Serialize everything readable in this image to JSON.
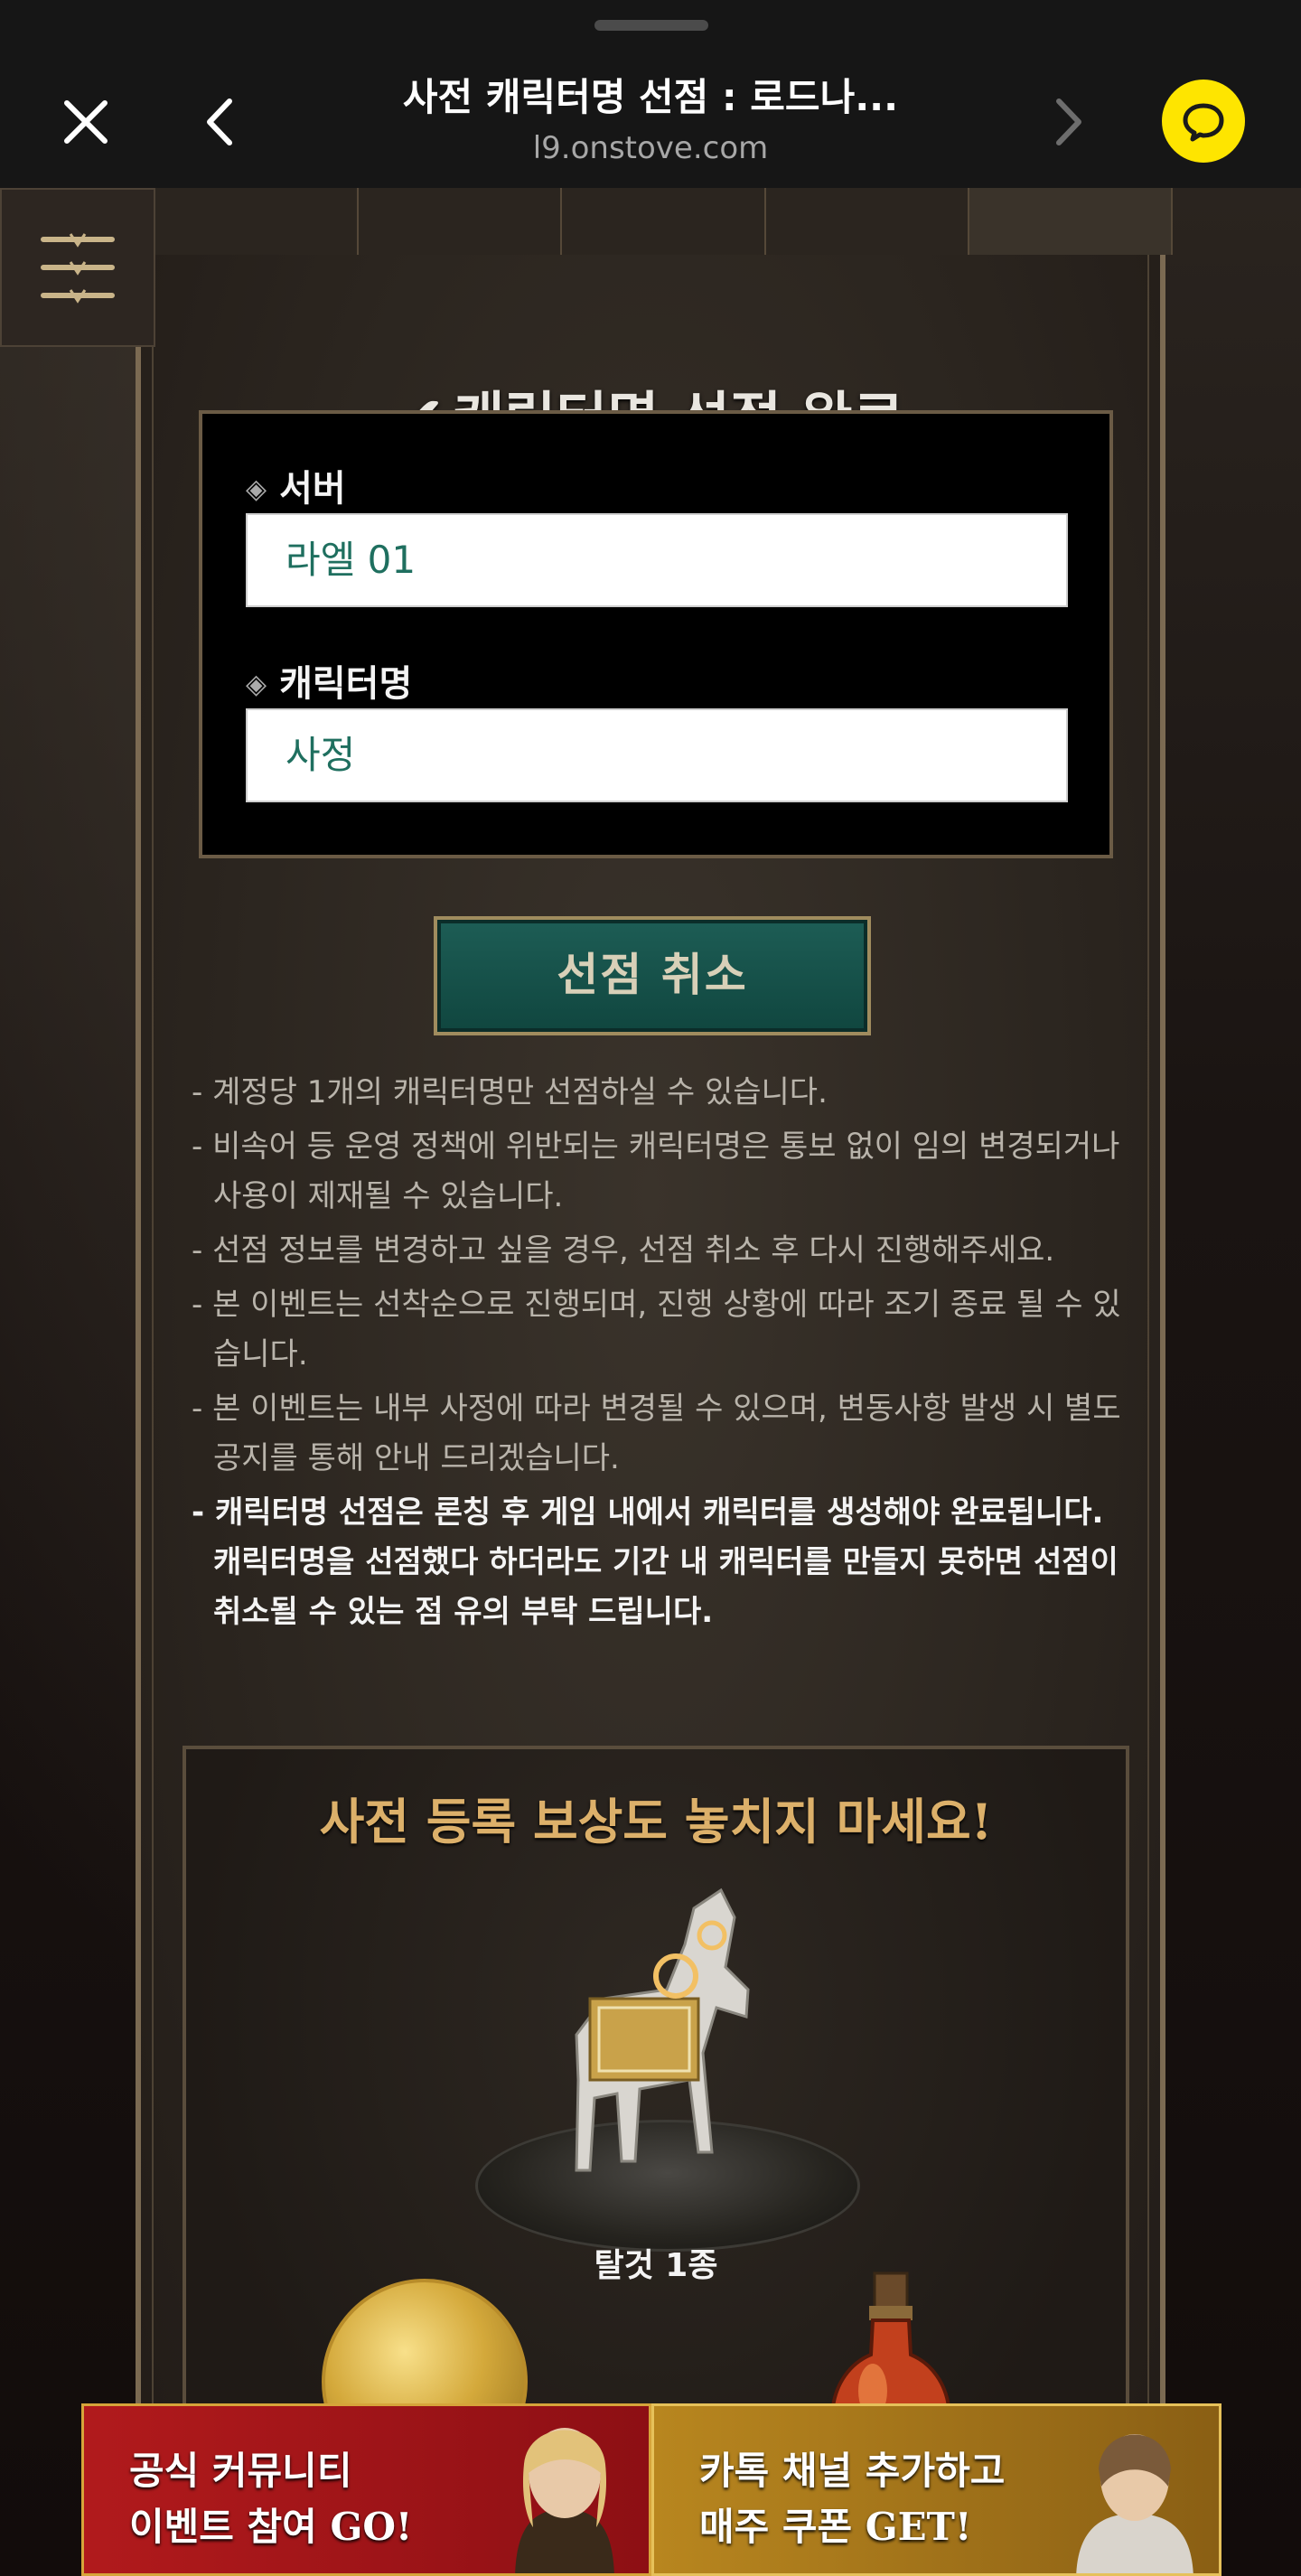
{
  "browser": {
    "title": "사전 캐릭터명 선점 : 로드나...",
    "url": "l9.onstove.com",
    "close_icon": "close-icon",
    "back_icon": "chevron-left-icon",
    "forward_icon": "chevron-right-icon",
    "kakaotalk_icon": "kakaotalk-icon"
  },
  "completion": {
    "title": "캐릭터명 선점 완료",
    "check_icon": "✔",
    "server_label": "서버",
    "server_value": "라엘 01",
    "character_label": "캐릭터명",
    "character_value": "사정",
    "cancel_button": "선점 취소"
  },
  "notes": [
    "- 계정당 1개의 캐릭터명만 선점하실 수 있습니다.",
    "- 비속어 등 운영 정책에 위반되는 캐릭터명은 통보 없이 임의 변경되거나 사용이 제재될 수 있습니다.",
    "- 선점 정보를 변경하고 싶을 경우, 선점 취소 후 다시 진행해주세요.",
    "- 본 이벤트는 선착순으로 진행되며, 진행 상황에 따라 조기 종료 될 수 있습니다.",
    "- 본 이벤트는 내부 사정에 따라 변경될 수 있으며, 변동사항 발생 시 별도 공지를 통해 안내 드리겠습니다.",
    "- 캐릭터명 선점은 론칭 후 게임 내에서 캐릭터를 생성해야 완료됩니다. 캐릭터명을 선점했다 하더라도 기간 내 캐릭터를 만들지 못하면 선점이 취소될 수 있는 점 유의 부탁 드립니다."
  ],
  "promo": {
    "title": "사전 등록 보상도 놓치지 마세요!",
    "mount_label": "탈것 1종"
  },
  "banners": [
    {
      "line1": "공식 커뮤니티",
      "line2": "이벤트 참여 GO!"
    },
    {
      "line1": "카톡 채널 추가하고",
      "line2": "매주 쿠폰 GET!"
    }
  ],
  "colors": {
    "accent_teal": "#1d5d55",
    "value_text": "#1f6f5f",
    "gold_title": "#dcb06a",
    "kakao_yellow": "#fee500",
    "banner_red": "#b11a1c",
    "banner_gold": "#b8861f"
  }
}
